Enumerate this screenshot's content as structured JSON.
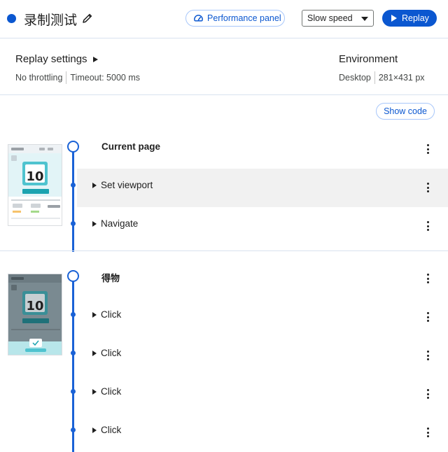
{
  "header": {
    "title": "录制测试",
    "performance_label": "Performance panel",
    "speed_selected": "Slow speed",
    "replay_label": "Replay",
    "accent": "#0b57d0"
  },
  "settings": {
    "title": "Replay settings",
    "throttling": "No throttling",
    "timeout": "Timeout: 5000 ms"
  },
  "environment": {
    "title": "Environment",
    "device": "Desktop",
    "size": "281×431 px"
  },
  "show_code_label": "Show code",
  "sections": [
    {
      "title": "Current page",
      "thumb_number": "10",
      "steps": [
        "Set viewport",
        "Navigate"
      ]
    },
    {
      "title": "得物",
      "thumb_number": "10",
      "steps": [
        "Click",
        "Click",
        "Click",
        "Click"
      ]
    }
  ],
  "icons": {
    "edit": "pencil-icon",
    "performance": "gauge-icon",
    "dropdown": "caret-down-icon",
    "replay": "play-icon",
    "expand": "triangle-right-icon",
    "menu": "kebab-menu-icon"
  }
}
